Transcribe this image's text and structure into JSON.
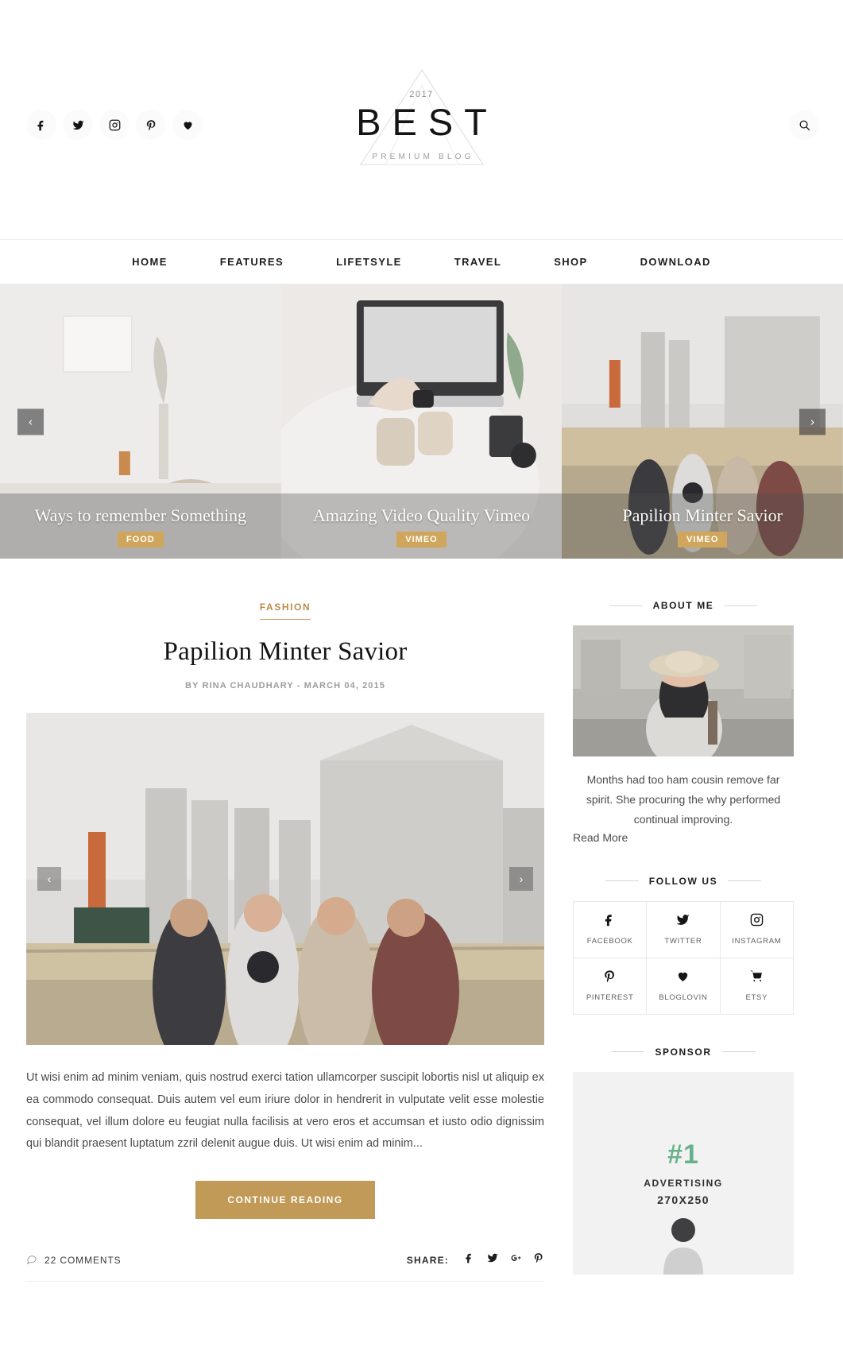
{
  "header": {
    "logo": {
      "year": "2017",
      "name": "BEST",
      "tagline": "PREMIUM BLOG"
    },
    "social": [
      {
        "name": "facebook-icon",
        "label": "Facebook"
      },
      {
        "name": "twitter-icon",
        "label": "Twitter"
      },
      {
        "name": "instagram-icon",
        "label": "Instagram"
      },
      {
        "name": "pinterest-icon",
        "label": "Pinterest"
      },
      {
        "name": "bloglovin-icon",
        "label": "Bloglovin"
      }
    ],
    "search_icon": "search-icon"
  },
  "nav": {
    "items": [
      {
        "label": "HOME"
      },
      {
        "label": "FEATURES"
      },
      {
        "label": "LIFETSYLE"
      },
      {
        "label": "TRAVEL"
      },
      {
        "label": "SHOP"
      },
      {
        "label": "DOWNLOAD"
      }
    ]
  },
  "slider": {
    "prev": "‹",
    "next": "›",
    "slides": [
      {
        "title": "Ways to remember Something",
        "badge": "FOOD"
      },
      {
        "title": "Amazing Video Quality Vimeo",
        "badge": "VIMEO"
      },
      {
        "title": "Papilion Minter Savior",
        "badge": "VIMEO"
      }
    ]
  },
  "post": {
    "category": "FASHION",
    "title": "Papilion Minter Savior",
    "meta": "BY RINA CHAUDHARY - MARCH 04, 2015",
    "figure_prev": "‹",
    "figure_next": "›",
    "excerpt": "Ut wisi enim ad minim veniam, quis nostrud exerci tation ullamcorper suscipit lobortis nisl ut aliquip ex ea commodo consequat. Duis autem vel eum iriure dolor in hendrerit in vulputate velit esse molestie consequat, vel illum dolore eu feugiat nulla facilisis at vero eros et accumsan et iusto odio dignissim qui blandit praesent luptatum zzril delenit augue duis. Ut wisi enim ad minim...",
    "button": "CONTINUE READING",
    "comments": "22 COMMENTS",
    "share_label": "SHARE:",
    "share_icons": [
      {
        "name": "facebook-icon"
      },
      {
        "name": "twitter-icon"
      },
      {
        "name": "google-plus-icon"
      },
      {
        "name": "pinterest-icon"
      }
    ]
  },
  "sidebar": {
    "about": {
      "title": "ABOUT ME",
      "text": "Months had too ham cousin remove far spirit. She procuring the why performed continual improving.",
      "read_more": "Read More"
    },
    "follow": {
      "title": "FOLLOW US",
      "items": [
        {
          "icon": "facebook-icon",
          "label": "FACEBOOK"
        },
        {
          "icon": "twitter-icon",
          "label": "TWITTER"
        },
        {
          "icon": "instagram-icon",
          "label": "INSTAGRAM"
        },
        {
          "icon": "pinterest-icon",
          "label": "PINTEREST"
        },
        {
          "icon": "bloglovin-icon",
          "label": "BLOGLOVIN"
        },
        {
          "icon": "cart-icon",
          "label": "ETSY"
        }
      ]
    },
    "sponsor": {
      "title": "SPONSOR",
      "rank": "#1",
      "line1": "ADVERTISING",
      "line2": "270X250"
    }
  },
  "colors": {
    "accent_gold": "#c09a56",
    "badge_gold": "#d0a55c",
    "category_gold": "#b98c4e",
    "sponsor_green": "#67b18c",
    "text_dark": "#141414"
  }
}
